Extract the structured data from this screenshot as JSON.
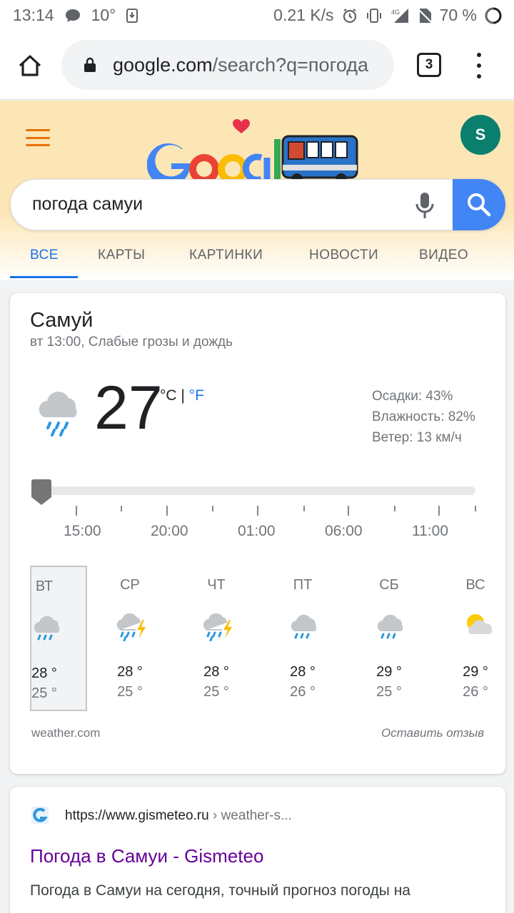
{
  "status_bar": {
    "time": "13:14",
    "temp": "10°",
    "speed": "0.21 K/s",
    "network": "4G",
    "battery": "70 %"
  },
  "browser": {
    "url_domain": "google.com",
    "url_rest": "/search?q=погода",
    "tab_count": "3"
  },
  "header": {
    "avatar_letter": "S",
    "search_query": "погода самуи",
    "tabs": [
      "ВСЕ",
      "КАРТЫ",
      "КАРТИНКИ",
      "НОВОСТИ",
      "ВИДЕО"
    ]
  },
  "weather": {
    "city": "Самуй",
    "subtitle": "вт 13:00, Слабые грозы и дождь",
    "temperature": "27",
    "unit_c": "°C",
    "unit_sep": " | ",
    "unit_f": "°F",
    "precipitation": "Осадки: 43%",
    "humidity": "Влажность: 82%",
    "wind": "Ветер: 13 км/ч",
    "times": [
      "15:00",
      "20:00",
      "01:00",
      "06:00",
      "11:00"
    ],
    "days": [
      {
        "name": "ВТ",
        "hi": "28 °",
        "lo": "25 °",
        "icon": "rain-cloud-icon"
      },
      {
        "name": "СР",
        "hi": "28 °",
        "lo": "25 °",
        "icon": "thunderstorm-icon"
      },
      {
        "name": "ЧТ",
        "hi": "28 °",
        "lo": "25 °",
        "icon": "thunderstorm-icon"
      },
      {
        "name": "ПТ",
        "hi": "28 °",
        "lo": "26 °",
        "icon": "rain-cloud-icon"
      },
      {
        "name": "СБ",
        "hi": "29 °",
        "lo": "25 °",
        "icon": "rain-cloud-icon"
      },
      {
        "name": "ВС",
        "hi": "29 °",
        "lo": "26 °",
        "icon": "partly-cloudy-icon"
      }
    ],
    "source": "weather.com",
    "feedback": "Оставить отзыв"
  },
  "result": {
    "url": "https://www.gismeteo.ru",
    "url_path": " › weather-s...",
    "title": "Погода в Самуи - Gismeteo",
    "snippet": "Погода в Самуи на сегодня, точный прогноз погоды на"
  },
  "colors": {
    "accent_blue": "#1a73e8",
    "google_blue": "#4285f4",
    "doodle_bg": "#fce6b6",
    "avatar_green": "#0b7f6e",
    "visited_link": "#660099"
  }
}
